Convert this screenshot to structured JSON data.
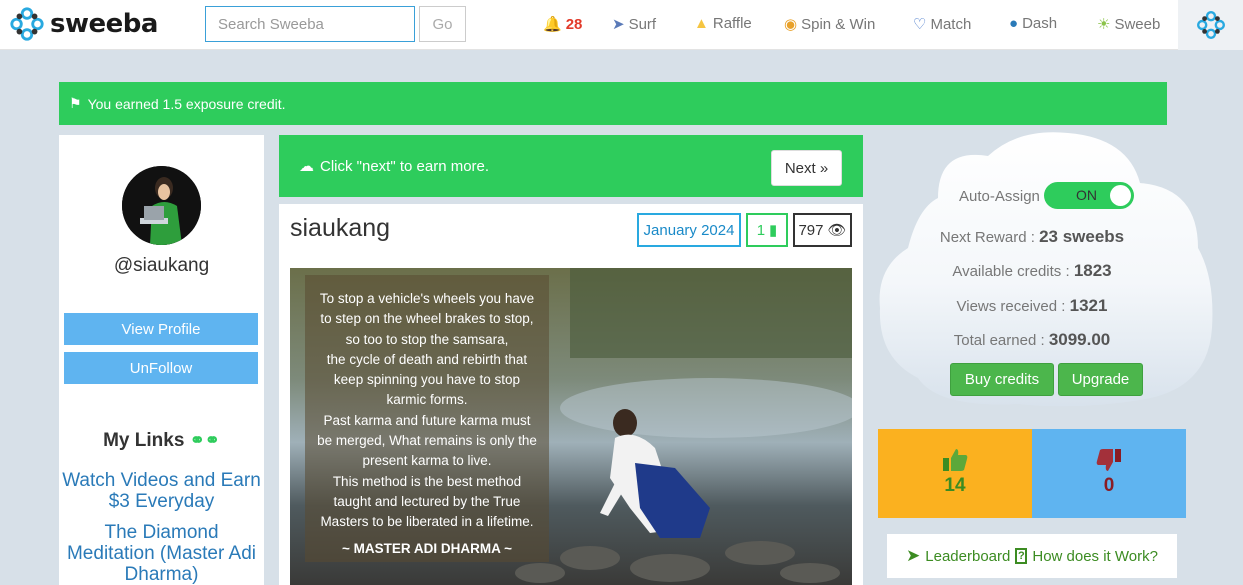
{
  "brand": {
    "name": "sweeba"
  },
  "search": {
    "placeholder": "Search Sweeba",
    "go_label": "Go"
  },
  "nav": {
    "notifications_count": "28",
    "items": [
      {
        "label": "Surf",
        "icon": "rocket-icon"
      },
      {
        "label": "Raffle",
        "icon": "ticket-icon"
      },
      {
        "label": "Spin & Win",
        "icon": "wheel-icon"
      },
      {
        "label": "Match",
        "icon": "heart-icon"
      },
      {
        "label": "Dash",
        "icon": "globe-icon"
      },
      {
        "label": "Sweeb",
        "icon": "sun-icon"
      }
    ]
  },
  "alert": {
    "text": "You earned 1.5 exposure credit."
  },
  "profile": {
    "username": "@siaukang",
    "view_profile": "View Profile",
    "unfollow": "UnFollow",
    "my_links_title": "My Links",
    "links": [
      "Watch Videos and Earn $3 Everyday",
      "The Diamond Meditation (Master Adi Dharma)"
    ]
  },
  "earn": {
    "text": "Click \"next\" to earn more.",
    "next_label": "Next »"
  },
  "post": {
    "title": "siaukang",
    "date": "January 2024",
    "comments": "1",
    "views": "797",
    "quote_lines": [
      "To stop a vehicle's wheels you have",
      "to step on the wheel brakes to stop,",
      "so too to stop the samsara,",
      "the cycle of death and rebirth that",
      "keep spinning you have to stop",
      "karmic forms.",
      "Past karma and future karma must",
      "be merged, What remains is only the",
      "present karma to live.",
      "This method is the best method",
      "taught and lectured by the True",
      "Masters to be liberated in a lifetime."
    ],
    "quote_author": "~ MASTER ADI DHARMA ~"
  },
  "stats": {
    "auto_assign_label": "Auto-Assign",
    "auto_assign_state": "ON",
    "next_reward_label": "Next Reward :",
    "next_reward_value": "23 sweebs",
    "available_label": "Available credits :",
    "available_value": "1823",
    "views_label": "Views received :",
    "views_value": "1321",
    "earned_label": "Total earned :",
    "earned_value": "3099.00",
    "buy_label": "Buy credits",
    "upgrade_label": "Upgrade"
  },
  "votes": {
    "up": "14",
    "down": "0"
  },
  "leaderboard": {
    "label": "Leaderboard",
    "how_label": "How does it Work?"
  },
  "colors": {
    "green": "#2ecc5c",
    "blue": "#5fb4f0",
    "orange": "#fbb11f",
    "bg": "#d7e0e8"
  }
}
